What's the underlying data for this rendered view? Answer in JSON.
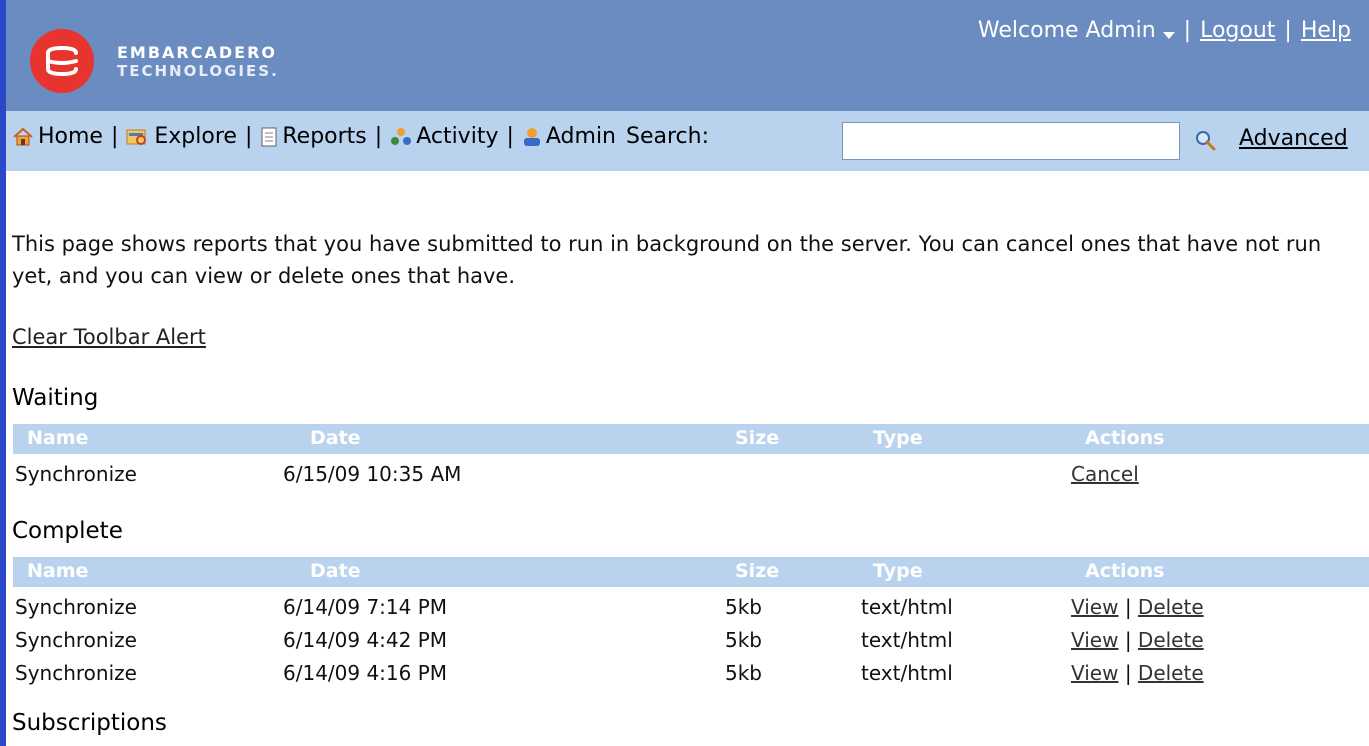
{
  "header": {
    "logo_line1": "EMBARCADERO",
    "logo_line2": "TECHNOLOGIES.",
    "welcome": "Welcome Admin",
    "logout": "Logout",
    "help": "Help"
  },
  "nav": {
    "home": "Home",
    "explore": "Explore",
    "reports": "Reports",
    "activity": "Activity",
    "admin": "Admin",
    "search_label": "Search:",
    "search_value": "",
    "advanced": "Advanced"
  },
  "main": {
    "description": "This page shows reports that you have submitted to run in background on the server. You can cancel ones that have not run yet, and you can view or delete ones that have.",
    "clear_alert": "Clear Toolbar Alert",
    "columns": {
      "name": "Name",
      "date": "Date",
      "size": "Size",
      "type": "Type",
      "actions": "Actions"
    },
    "waiting": {
      "title": "Waiting",
      "rows": [
        {
          "name": "Synchronize",
          "date": "6/15/09 10:35 AM",
          "size": "",
          "type": "",
          "action1": "Cancel"
        }
      ]
    },
    "complete": {
      "title": "Complete",
      "rows": [
        {
          "name": "Synchronize",
          "date": "6/14/09 7:14 PM",
          "size": "5kb",
          "type": "text/html",
          "view": "View",
          "delete": "Delete"
        },
        {
          "name": "Synchronize",
          "date": "6/14/09 4:42 PM",
          "size": "5kb",
          "type": "text/html",
          "view": "View",
          "delete": "Delete"
        },
        {
          "name": "Synchronize",
          "date": "6/14/09 4:16 PM",
          "size": "5kb",
          "type": "text/html",
          "view": "View",
          "delete": "Delete"
        }
      ]
    },
    "subscriptions": {
      "title": "Subscriptions"
    }
  },
  "colors": {
    "header_bg": "#6a8cc0",
    "nav_bg": "#b9d3ef",
    "logo_red": "#e8342e",
    "left_edge": "#2a48c8"
  }
}
